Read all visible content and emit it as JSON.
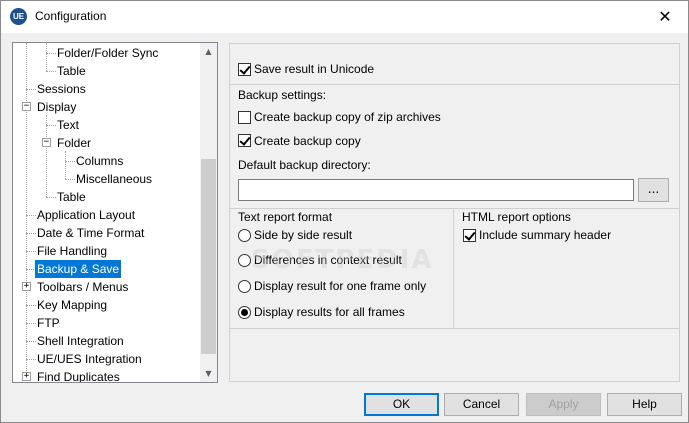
{
  "window": {
    "title": "Configuration",
    "close_glyph": "✕",
    "app_icon_text": "UE"
  },
  "tree": {
    "items": [
      {
        "label": "Folder/Folder Sync"
      },
      {
        "label": "Table"
      },
      {
        "label": "Sessions"
      },
      {
        "label": "Display",
        "expander": "−"
      },
      {
        "label": "Text"
      },
      {
        "label": "Folder",
        "expander": "−"
      },
      {
        "label": "Columns"
      },
      {
        "label": "Miscellaneous"
      },
      {
        "label": "Table"
      },
      {
        "label": "Application Layout"
      },
      {
        "label": "Date & Time Format"
      },
      {
        "label": "File Handling"
      },
      {
        "label": "Backup & Save",
        "selected": true
      },
      {
        "label": "Toolbars / Menus",
        "expander": "+"
      },
      {
        "label": "Key Mapping"
      },
      {
        "label": "FTP"
      },
      {
        "label": "Shell Integration"
      },
      {
        "label": "UE/UES Integration"
      },
      {
        "label": "Find Duplicates",
        "expander": "+"
      }
    ],
    "scroll_up_glyph": "▲",
    "scroll_down_glyph": "▼"
  },
  "pane": {
    "save_unicode": {
      "label": "Save result in Unicode",
      "checked": true
    },
    "backup_settings_label": "Backup settings:",
    "backup_zip": {
      "label": "Create backup copy of zip archives",
      "checked": false
    },
    "backup_copy": {
      "label": "Create backup copy",
      "checked": true
    },
    "backup_dir_label": "Default backup directory:",
    "backup_dir_value": "",
    "browse_label": "...",
    "text_report": {
      "title": "Text report format",
      "options": [
        {
          "label": "Side by side result",
          "selected": false
        },
        {
          "label": "Differences in context result",
          "selected": false
        },
        {
          "label": "Display result for one frame only",
          "selected": false
        },
        {
          "label": "Display results for all frames",
          "selected": true
        }
      ]
    },
    "html_report": {
      "title": "HTML report options",
      "include_summary": {
        "label": "Include summary header",
        "checked": true
      }
    }
  },
  "buttons": {
    "ok": "OK",
    "cancel": "Cancel",
    "apply": "Apply",
    "help": "Help"
  },
  "watermark": "SOFTPEDIA",
  "colors": {
    "selection": "#0078d7",
    "app_icon": "#1e4f8f"
  }
}
